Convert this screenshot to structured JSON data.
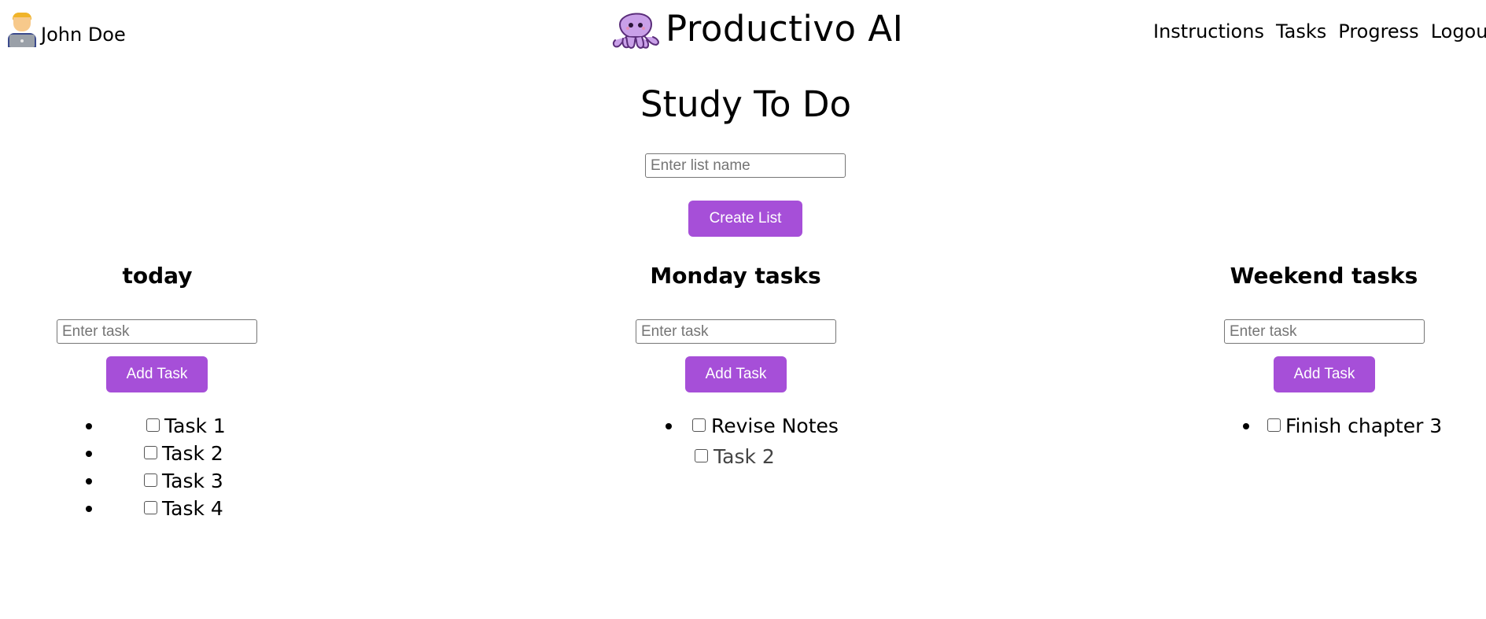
{
  "header": {
    "user_name": "John Doe",
    "avatar_icon": "man-technologist-icon",
    "brand_icon": "octopus-icon",
    "brand_name": "Productivo AI",
    "nav": [
      "Instructions",
      "Tasks",
      "Progress",
      "Logou"
    ]
  },
  "page": {
    "title": "Study To Do",
    "list_name_placeholder": "Enter list name",
    "list_name_value": "",
    "create_button": "Create List"
  },
  "lists": [
    {
      "name": "today",
      "task_placeholder": "Enter task",
      "add_button": "Add Task",
      "tasks": [
        {
          "label": "Task 1",
          "checked": false
        },
        {
          "label": "Task 2",
          "checked": false
        },
        {
          "label": "Task 3",
          "checked": false
        },
        {
          "label": "Task 4",
          "checked": false
        }
      ]
    },
    {
      "name": "Monday tasks",
      "task_placeholder": "Enter task",
      "add_button": "Add Task",
      "tasks": [
        {
          "label": "Revise Notes",
          "checked": false
        },
        {
          "label": "Task 2",
          "checked": false
        }
      ]
    },
    {
      "name": "Weekend tasks",
      "task_placeholder": "Enter task",
      "add_button": "Add Task",
      "tasks": [
        {
          "label": "Finish chapter 3",
          "checked": false
        }
      ]
    }
  ],
  "colors": {
    "accent": "#a64fd8",
    "octopus_fill": "#c9a0e8",
    "octopus_outline": "#5a2d7a"
  }
}
